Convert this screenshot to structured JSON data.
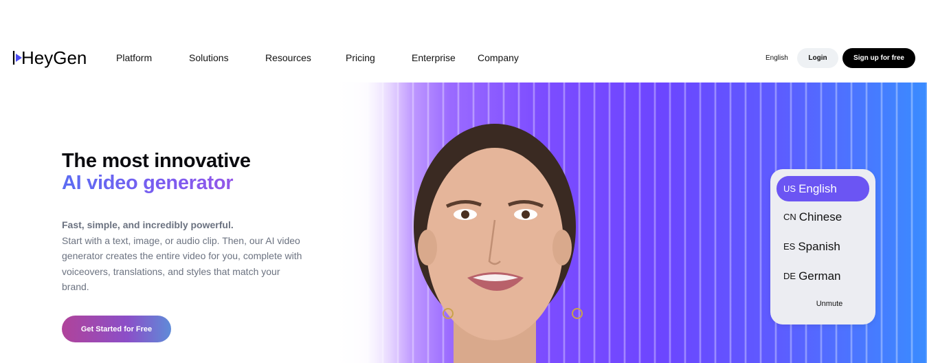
{
  "nav": {
    "logo": "HeyGen",
    "items": [
      "Platform",
      "Solutions",
      "Resources",
      "Pricing",
      "Enterprise",
      "Company"
    ],
    "language": "English",
    "login": "Login",
    "signup": "Sign up for free"
  },
  "hero": {
    "title_line1": "The most innovative",
    "title_line2": "AI video generator",
    "sub_bold": "Fast, simple, and incredibly powerful.",
    "sub_text": "Start with a text, image, or audio clip. Then, our AI video generator creates the entire video for you, complete with voiceovers, translations, and styles that match your brand.",
    "cta": "Get Started for Free"
  },
  "video_panel": {
    "languages": [
      {
        "code": "US",
        "label": "English",
        "active": true
      },
      {
        "code": "CN",
        "label": "Chinese",
        "active": false
      },
      {
        "code": "ES",
        "label": "Spanish",
        "active": false
      },
      {
        "code": "DE",
        "label": "German",
        "active": false
      }
    ],
    "unmute": "Unmute"
  },
  "colors": {
    "accent": "#6b55f3",
    "gradient_start": "#5b6cf2",
    "gradient_end": "#9a55e6",
    "cta_start": "#b0439a",
    "cta_end": "#5f8bd8"
  }
}
